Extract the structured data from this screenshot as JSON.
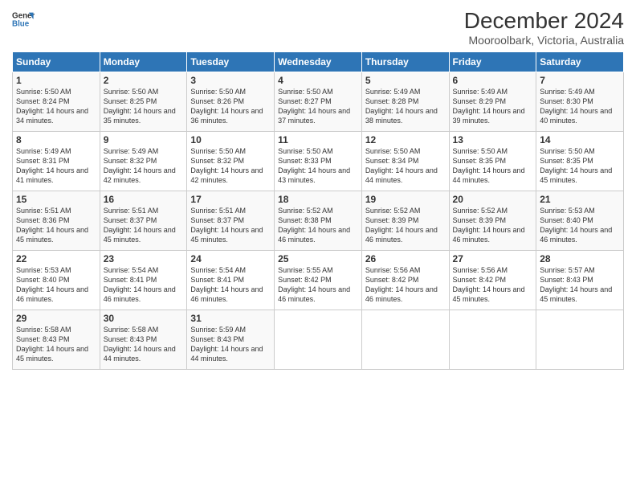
{
  "logo": {
    "line1": "General",
    "line2": "Blue"
  },
  "title": "December 2024",
  "subtitle": "Mooroolbark, Victoria, Australia",
  "days_header": [
    "Sunday",
    "Monday",
    "Tuesday",
    "Wednesday",
    "Thursday",
    "Friday",
    "Saturday"
  ],
  "weeks": [
    [
      {
        "day": "1",
        "rise": "5:50 AM",
        "set": "8:24 PM",
        "daylight": "14 hours and 34 minutes."
      },
      {
        "day": "2",
        "rise": "5:50 AM",
        "set": "8:25 PM",
        "daylight": "14 hours and 35 minutes."
      },
      {
        "day": "3",
        "rise": "5:50 AM",
        "set": "8:26 PM",
        "daylight": "14 hours and 36 minutes."
      },
      {
        "day": "4",
        "rise": "5:50 AM",
        "set": "8:27 PM",
        "daylight": "14 hours and 37 minutes."
      },
      {
        "day": "5",
        "rise": "5:49 AM",
        "set": "8:28 PM",
        "daylight": "14 hours and 38 minutes."
      },
      {
        "day": "6",
        "rise": "5:49 AM",
        "set": "8:29 PM",
        "daylight": "14 hours and 39 minutes."
      },
      {
        "day": "7",
        "rise": "5:49 AM",
        "set": "8:30 PM",
        "daylight": "14 hours and 40 minutes."
      }
    ],
    [
      {
        "day": "8",
        "rise": "5:49 AM",
        "set": "8:31 PM",
        "daylight": "14 hours and 41 minutes."
      },
      {
        "day": "9",
        "rise": "5:49 AM",
        "set": "8:32 PM",
        "daylight": "14 hours and 42 minutes."
      },
      {
        "day": "10",
        "rise": "5:50 AM",
        "set": "8:32 PM",
        "daylight": "14 hours and 42 minutes."
      },
      {
        "day": "11",
        "rise": "5:50 AM",
        "set": "8:33 PM",
        "daylight": "14 hours and 43 minutes."
      },
      {
        "day": "12",
        "rise": "5:50 AM",
        "set": "8:34 PM",
        "daylight": "14 hours and 44 minutes."
      },
      {
        "day": "13",
        "rise": "5:50 AM",
        "set": "8:35 PM",
        "daylight": "14 hours and 44 minutes."
      },
      {
        "day": "14",
        "rise": "5:50 AM",
        "set": "8:35 PM",
        "daylight": "14 hours and 45 minutes."
      }
    ],
    [
      {
        "day": "15",
        "rise": "5:51 AM",
        "set": "8:36 PM",
        "daylight": "14 hours and 45 minutes."
      },
      {
        "day": "16",
        "rise": "5:51 AM",
        "set": "8:37 PM",
        "daylight": "14 hours and 45 minutes."
      },
      {
        "day": "17",
        "rise": "5:51 AM",
        "set": "8:37 PM",
        "daylight": "14 hours and 45 minutes."
      },
      {
        "day": "18",
        "rise": "5:52 AM",
        "set": "8:38 PM",
        "daylight": "14 hours and 46 minutes."
      },
      {
        "day": "19",
        "rise": "5:52 AM",
        "set": "8:39 PM",
        "daylight": "14 hours and 46 minutes."
      },
      {
        "day": "20",
        "rise": "5:52 AM",
        "set": "8:39 PM",
        "daylight": "14 hours and 46 minutes."
      },
      {
        "day": "21",
        "rise": "5:53 AM",
        "set": "8:40 PM",
        "daylight": "14 hours and 46 minutes."
      }
    ],
    [
      {
        "day": "22",
        "rise": "5:53 AM",
        "set": "8:40 PM",
        "daylight": "14 hours and 46 minutes."
      },
      {
        "day": "23",
        "rise": "5:54 AM",
        "set": "8:41 PM",
        "daylight": "14 hours and 46 minutes."
      },
      {
        "day": "24",
        "rise": "5:54 AM",
        "set": "8:41 PM",
        "daylight": "14 hours and 46 minutes."
      },
      {
        "day": "25",
        "rise": "5:55 AM",
        "set": "8:42 PM",
        "daylight": "14 hours and 46 minutes."
      },
      {
        "day": "26",
        "rise": "5:56 AM",
        "set": "8:42 PM",
        "daylight": "14 hours and 46 minutes."
      },
      {
        "day": "27",
        "rise": "5:56 AM",
        "set": "8:42 PM",
        "daylight": "14 hours and 45 minutes."
      },
      {
        "day": "28",
        "rise": "5:57 AM",
        "set": "8:43 PM",
        "daylight": "14 hours and 45 minutes."
      }
    ],
    [
      {
        "day": "29",
        "rise": "5:58 AM",
        "set": "8:43 PM",
        "daylight": "14 hours and 45 minutes."
      },
      {
        "day": "30",
        "rise": "5:58 AM",
        "set": "8:43 PM",
        "daylight": "14 hours and 44 minutes."
      },
      {
        "day": "31",
        "rise": "5:59 AM",
        "set": "8:43 PM",
        "daylight": "14 hours and 44 minutes."
      },
      null,
      null,
      null,
      null
    ]
  ]
}
